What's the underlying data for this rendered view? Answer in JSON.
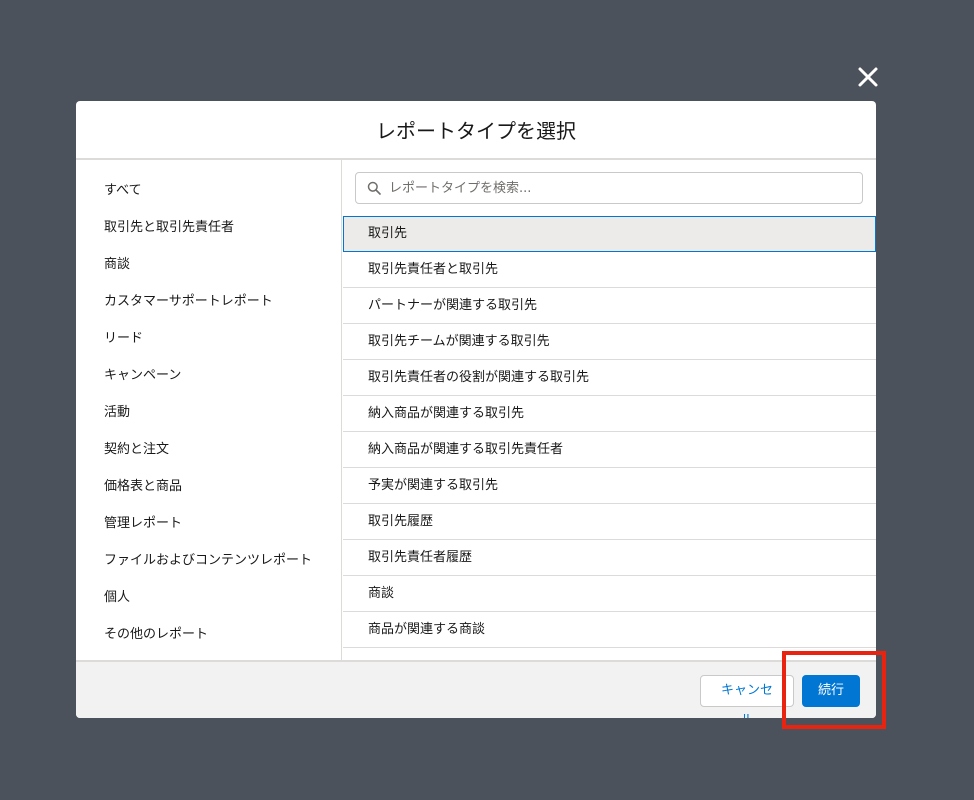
{
  "modal": {
    "title": "レポートタイプを選択"
  },
  "sidebar": {
    "items": [
      "すべて",
      "取引先と取引先責任者",
      "商談",
      "カスタマーサポートレポート",
      "リード",
      "キャンペーン",
      "活動",
      "契約と注文",
      "価格表と商品",
      "管理レポート",
      "ファイルおよびコンテンツレポート",
      "個人",
      "その他のレポート"
    ]
  },
  "search": {
    "placeholder": "レポートタイプを検索..."
  },
  "report_types": [
    "取引先",
    "取引先責任者と取引先",
    "パートナーが関連する取引先",
    "取引先チームが関連する取引先",
    "取引先責任者の役割が関連する取引先",
    "納入商品が関連する取引先",
    "納入商品が関連する取引先責任者",
    "予実が関連する取引先",
    "取引先履歴",
    "取引先責任者履歴",
    "商談",
    "商品が関連する商談"
  ],
  "footer": {
    "cancel_label": "キャンセル",
    "continue_label": "続行"
  },
  "colors": {
    "overlay": "#4b525c",
    "brand": "#0176d3",
    "highlight": "#e8230f",
    "selected_row": "#ecebea"
  },
  "icons": {
    "close": "close-icon",
    "search": "search-icon"
  }
}
